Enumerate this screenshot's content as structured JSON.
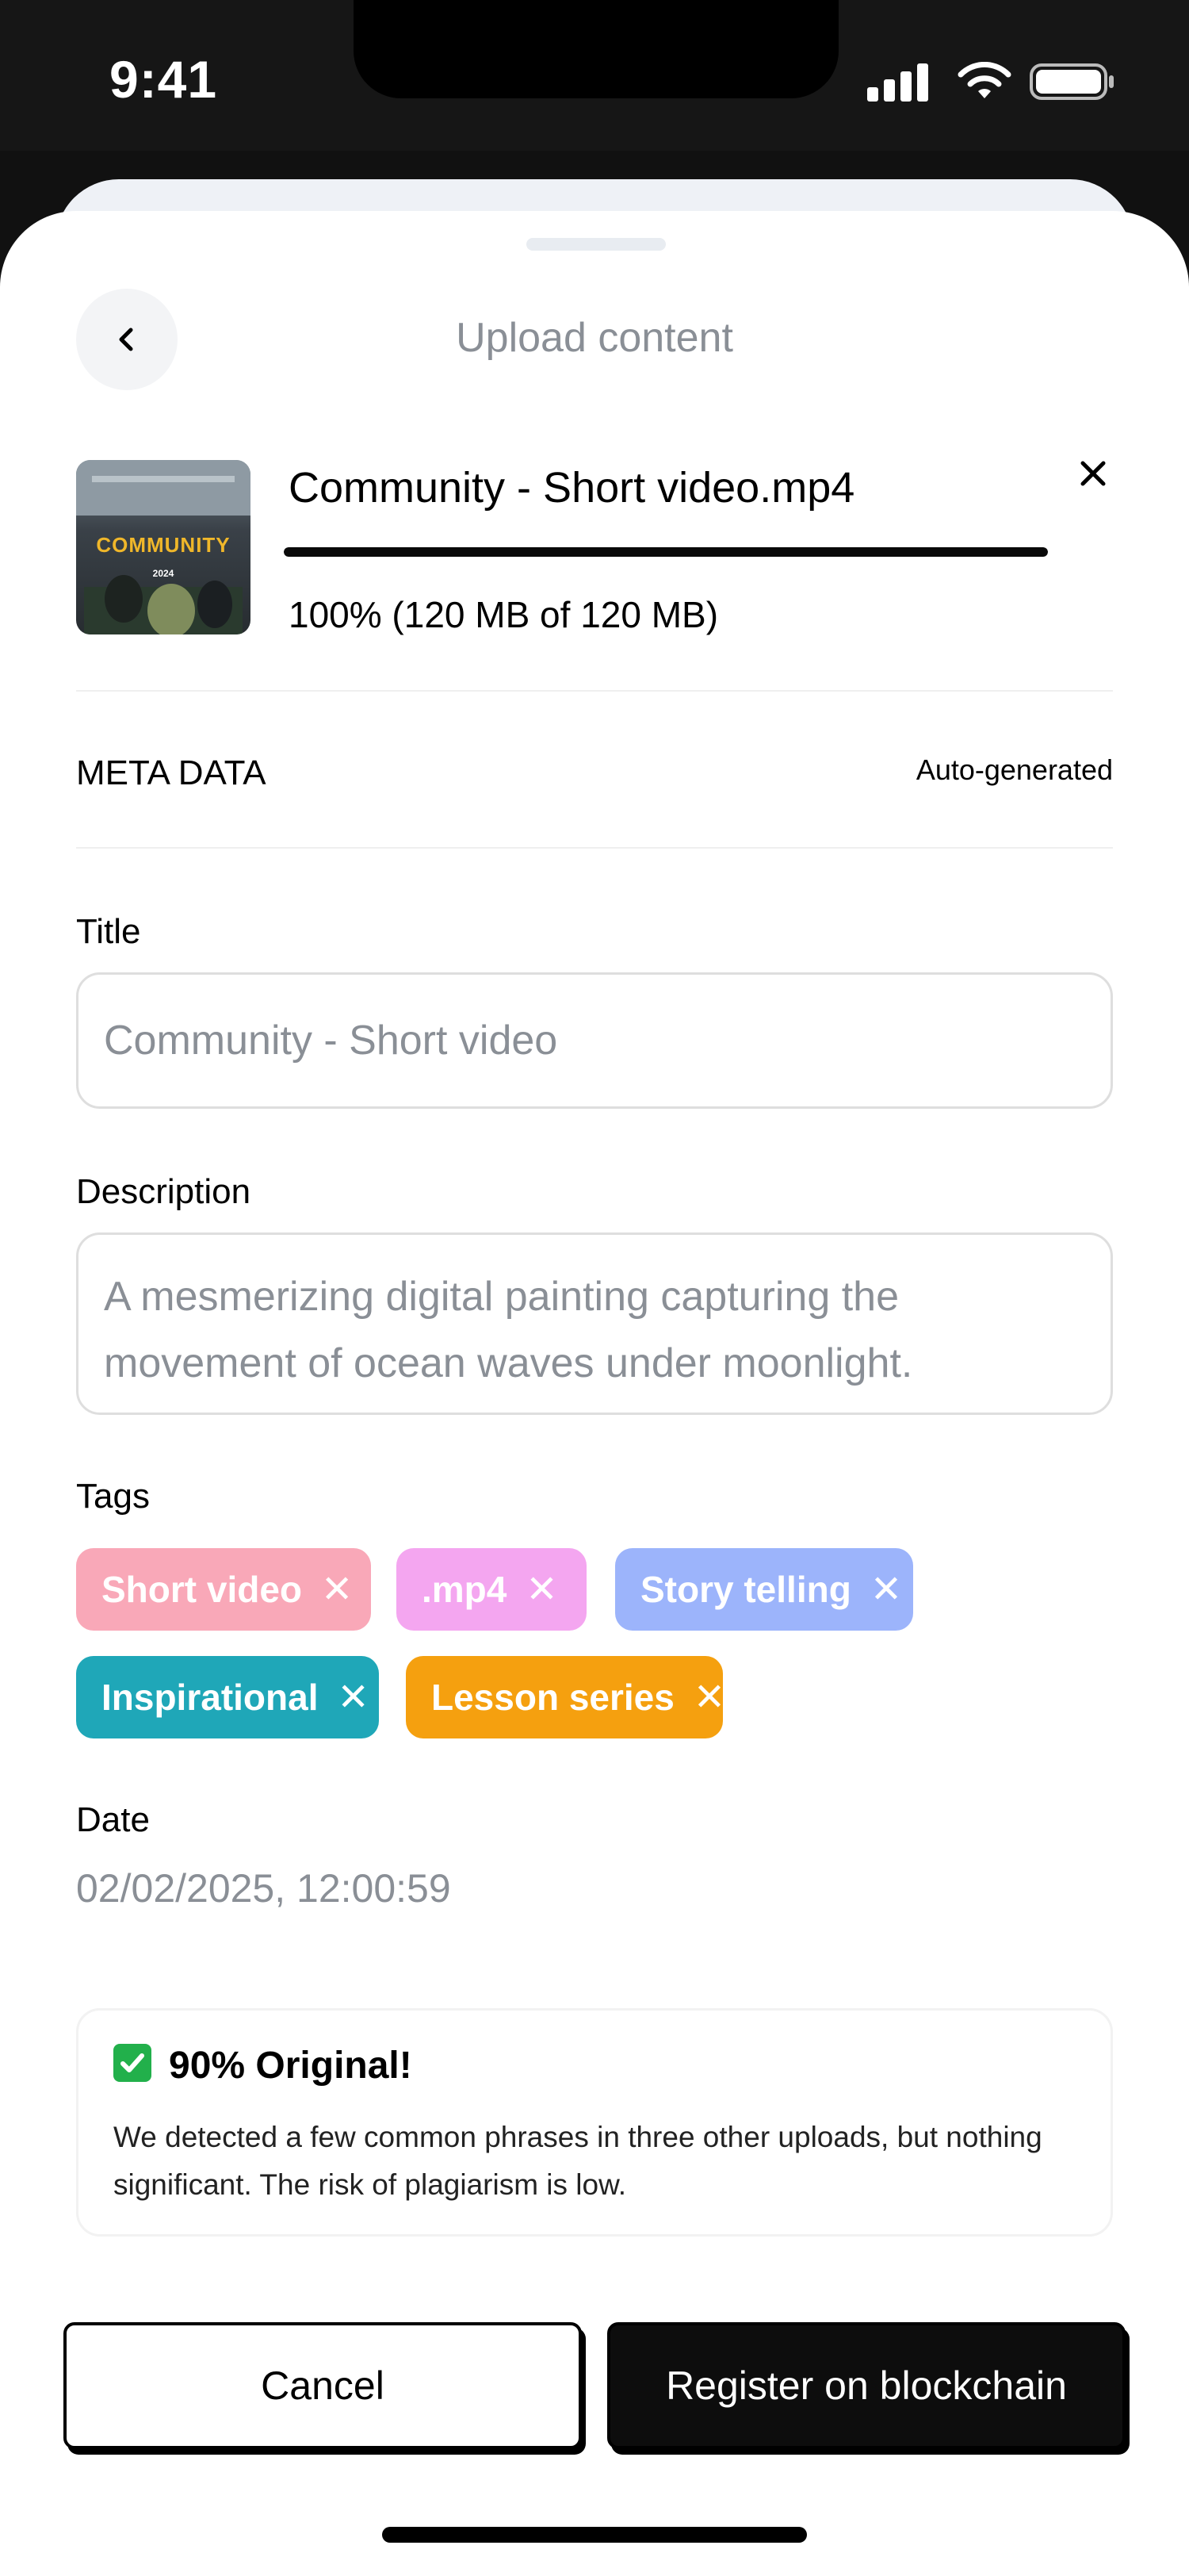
{
  "status_bar": {
    "time": "9:41",
    "signal_icon": "signal-icon",
    "wifi_icon": "wifi-icon",
    "battery_icon": "battery-icon"
  },
  "header": {
    "title": "Upload content",
    "back_icon": "chevron-left-icon"
  },
  "upload": {
    "file_name": "Community - Short video.mp4",
    "progress_text": "100% (120 MB of 120 MB)",
    "progress_fraction": 1.0,
    "thumbnail_title": "COMMUNITY",
    "thumbnail_year": "2024",
    "close_icon": "close-icon"
  },
  "meta": {
    "label": "META DATA",
    "status": "Auto-generated"
  },
  "form": {
    "title_label": "Title",
    "title_value": "Community - Short video",
    "description_label": "Description",
    "description_value": "A mesmerizing digital painting capturing the movement of ocean waves under moonlight.",
    "tags_label": "Tags",
    "tags": [
      {
        "label": "Short video",
        "color": "#f9a8b8"
      },
      {
        "label": ".mp4",
        "color": "#f4a6f0"
      },
      {
        "label": "Story telling",
        "color": "#9cb4fb"
      },
      {
        "label": "Inspirational",
        "color": "#1fa7b8"
      },
      {
        "label": "Lesson series",
        "color": "#f5a00f"
      }
    ],
    "date_label": "Date",
    "date_value": "02/02/2025, 12:00:59"
  },
  "originality": {
    "icon": "check-icon",
    "title": "90% Original!",
    "body": "We detected a few common phrases in three other uploads, but nothing significant. The risk of plagiarism is low."
  },
  "actions": {
    "cancel_label": "Cancel",
    "register_label": "Register on blockchain"
  }
}
